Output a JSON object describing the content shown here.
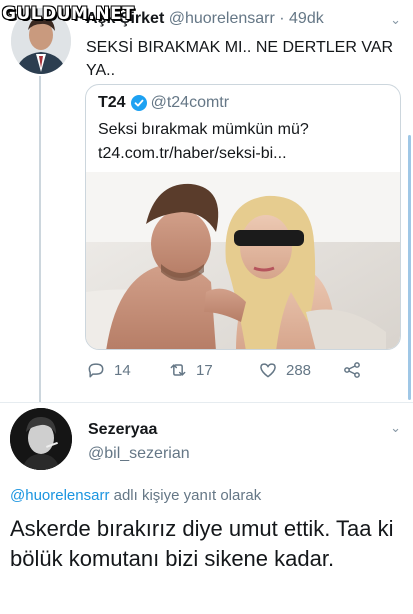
{
  "watermark": "GULDUM.NET",
  "tweet1": {
    "name": "Aşk Şirket",
    "handle": "@huorelensarr",
    "time": "· 49dk",
    "text": "SEKSİ BIRAKMAK MI.. NE DERTLER VAR YA.."
  },
  "quote": {
    "name": "T24",
    "handle": "@t24comtr",
    "text_line1": "Seksi bırakmak mümkün mü?",
    "text_line2": "t24.com.tr/haber/seksi-bi..."
  },
  "actions": {
    "reply_count": "14",
    "retweet_count": "17",
    "like_count": "288"
  },
  "tweet2": {
    "name": "Sezeryaa",
    "handle": "@bil_sezerian",
    "replying_mention": "@huorelensarr",
    "replying_suffix": " adlı kişiye yanıt olarak",
    "text": "Askerde bırakırız diye umut ettik. Taa ki bölük komutanı bizi sikene kadar."
  },
  "colors": {
    "accent": "#1b95e0",
    "muted": "#657786",
    "border": "#ccd6dd"
  }
}
